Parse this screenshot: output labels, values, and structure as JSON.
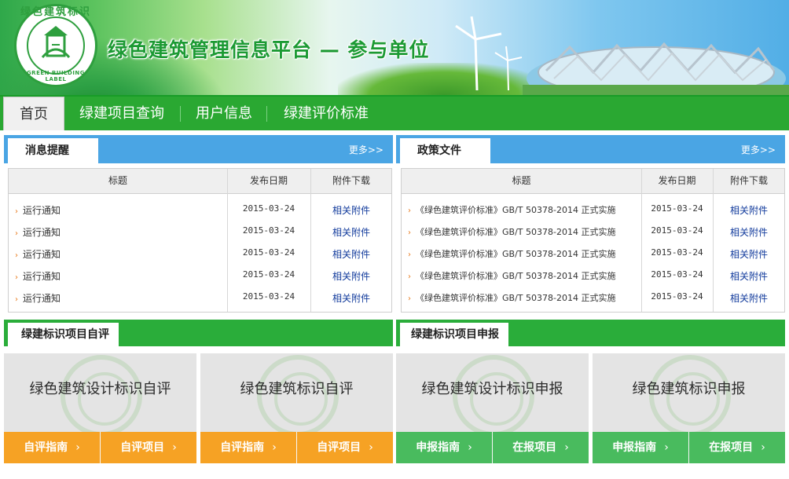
{
  "banner": {
    "logo_cn": "绿色建筑标识",
    "logo_en": "GREEN BUILDING LABEL",
    "title": "绿色建筑管理信息平台 — 参与单位"
  },
  "nav": {
    "items": [
      "首页",
      "绿建项目查询",
      "用户信息",
      "绿建评价标准"
    ]
  },
  "notice_panel": {
    "tab": "消息提醒",
    "more": "更多>>",
    "headers": [
      "标题",
      "发布日期",
      "附件下载"
    ],
    "rows": [
      {
        "title": "运行通知",
        "date": "2015-03-24",
        "attach": "相关附件"
      },
      {
        "title": "运行通知",
        "date": "2015-03-24",
        "attach": "相关附件"
      },
      {
        "title": "运行通知",
        "date": "2015-03-24",
        "attach": "相关附件"
      },
      {
        "title": "运行通知",
        "date": "2015-03-24",
        "attach": "相关附件"
      },
      {
        "title": "运行通知",
        "date": "2015-03-24",
        "attach": "相关附件"
      }
    ]
  },
  "policy_panel": {
    "tab": "政策文件",
    "more": "更多>>",
    "headers": [
      "标题",
      "发布日期",
      "附件下载"
    ],
    "rows": [
      {
        "title": "《绿色建筑评价标准》GB/T 50378-2014 正式实施",
        "date": "2015-03-24",
        "attach": "相关附件"
      },
      {
        "title": "《绿色建筑评价标准》GB/T 50378-2014 正式实施",
        "date": "2015-03-24",
        "attach": "相关附件"
      },
      {
        "title": "《绿色建筑评价标准》GB/T 50378-2014 正式实施",
        "date": "2015-03-24",
        "attach": "相关附件"
      },
      {
        "title": "《绿色建筑评价标准》GB/T 50378-2014 正式实施",
        "date": "2015-03-24",
        "attach": "相关附件"
      },
      {
        "title": "《绿色建筑评价标准》GB/T 50378-2014 正式实施",
        "date": "2015-03-24",
        "attach": "相关附件"
      }
    ]
  },
  "self_eval": {
    "heading": "绿建标识项目自评",
    "cards": [
      {
        "title": "绿色建筑设计标识自评",
        "btn_left": "自评指南",
        "btn_right": "自评项目"
      },
      {
        "title": "绿色建筑标识自评",
        "btn_left": "自评指南",
        "btn_right": "自评项目"
      }
    ]
  },
  "apply": {
    "heading": "绿建标识项目申报",
    "cards": [
      {
        "title": "绿色建筑设计标识申报",
        "btn_left": "申报指南",
        "btn_right": "在报项目"
      },
      {
        "title": "绿色建筑标识申报",
        "btn_left": "申报指南",
        "btn_right": "在报项目"
      }
    ]
  },
  "chevron": "›",
  "row_arrow": "›",
  "colors": {
    "nav_green": "#2aa832",
    "panel_blue": "#4aa5e4",
    "section_green": "#2aad3a",
    "orange_btn": "#f6a224",
    "green_btn": "#49bb5e",
    "link_blue": "#123b9c"
  }
}
